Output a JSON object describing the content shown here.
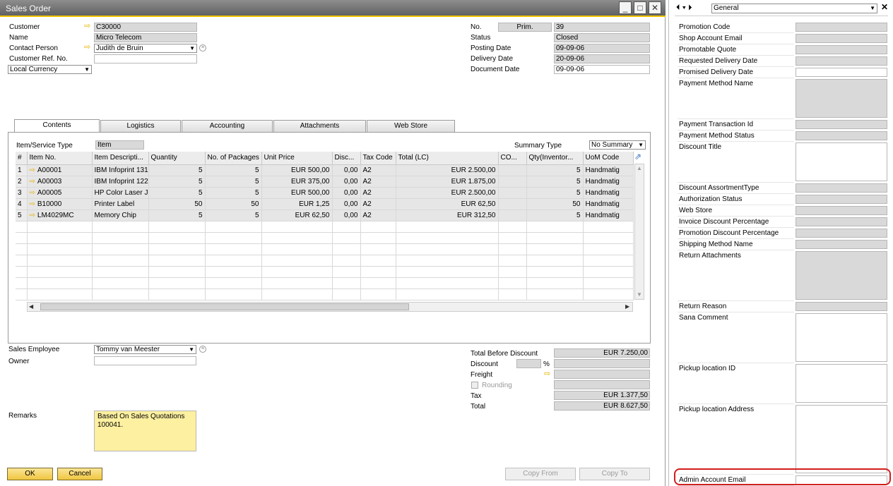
{
  "window": {
    "title": "Sales Order"
  },
  "header_left": {
    "customer_label": "Customer",
    "customer_value": "C30000",
    "name_label": "Name",
    "name_value": "Micro Telecom",
    "contact_label": "Contact Person",
    "contact_value": "Judith de Bruin",
    "ref_label": "Customer Ref. No.",
    "ref_value": "",
    "currency_value": "Local Currency"
  },
  "header_right": {
    "no_label": "No.",
    "series_value": "Prim.",
    "no_value": "39",
    "status_label": "Status",
    "status_value": "Closed",
    "posting_label": "Posting Date",
    "posting_value": "09-09-06",
    "delivery_label": "Delivery Date",
    "delivery_value": "20-09-06",
    "document_label": "Document Date",
    "document_value": "09-09-06"
  },
  "tabs": [
    {
      "label": "Contents"
    },
    {
      "label": "Logistics"
    },
    {
      "label": "Accounting"
    },
    {
      "label": "Attachments"
    },
    {
      "label": "Web Store"
    }
  ],
  "contents": {
    "item_type_label": "Item/Service Type",
    "item_type_value": "Item",
    "summary_label": "Summary Type",
    "summary_value": "No Summary",
    "columns": [
      "#",
      "Item No.",
      "Item Descripti...",
      "Quantity",
      "No. of Packages",
      "Unit Price",
      "Disc...",
      "Tax Code",
      "Total (LC)",
      "CO...",
      "Qty(Inventor...",
      "UoM Code"
    ],
    "rows": [
      {
        "n": "1",
        "item": "A00001",
        "desc": "IBM Infoprint 131",
        "qty": "5",
        "pkg": "5",
        "price": "EUR 500,00",
        "disc": "0,00",
        "tax": "A2",
        "total": "EUR 2.500,00",
        "co": "",
        "inv": "5",
        "uom": "Handmatig"
      },
      {
        "n": "2",
        "item": "A00003",
        "desc": "IBM Infoprint 122",
        "qty": "5",
        "pkg": "5",
        "price": "EUR 375,00",
        "disc": "0,00",
        "tax": "A2",
        "total": "EUR 1.875,00",
        "co": "",
        "inv": "5",
        "uom": "Handmatig"
      },
      {
        "n": "3",
        "item": "A00005",
        "desc": "HP Color Laser Je",
        "qty": "5",
        "pkg": "5",
        "price": "EUR 500,00",
        "disc": "0,00",
        "tax": "A2",
        "total": "EUR 2.500,00",
        "co": "",
        "inv": "5",
        "uom": "Handmatig"
      },
      {
        "n": "4",
        "item": "B10000",
        "desc": "Printer Label",
        "qty": "50",
        "pkg": "50",
        "price": "EUR 1,25",
        "disc": "0,00",
        "tax": "A2",
        "total": "EUR 62,50",
        "co": "",
        "inv": "50",
        "uom": "Handmatig"
      },
      {
        "n": "5",
        "item": "LM4029MC",
        "desc": "Memory Chip",
        "qty": "5",
        "pkg": "5",
        "price": "EUR 62,50",
        "disc": "0,00",
        "tax": "A2",
        "total": "EUR 312,50",
        "co": "",
        "inv": "5",
        "uom": "Handmatig"
      }
    ]
  },
  "footer_left": {
    "employee_label": "Sales Employee",
    "employee_value": "Tommy van Meester",
    "owner_label": "Owner",
    "owner_value": "",
    "remarks_label": "Remarks",
    "remarks_value": "Based On Sales Quotations 100041."
  },
  "totals": {
    "before_label": "Total Before Discount",
    "before_value": "EUR 7.250,00",
    "discount_label": "Discount",
    "percent_sign": "%",
    "freight_label": "Freight",
    "rounding_label": "Rounding",
    "tax_label": "Tax",
    "tax_value": "EUR 1.377,50",
    "total_label": "Total",
    "total_value": "EUR 8.627,50"
  },
  "buttons": {
    "ok": "OK",
    "cancel": "Cancel",
    "copy_from": "Copy From",
    "copy_to": "Copy To"
  },
  "udf": {
    "category": "General",
    "fields": [
      {
        "label": "Promotion Code",
        "h": 13,
        "white": false
      },
      {
        "label": "Shop Account Email",
        "h": 13,
        "white": false
      },
      {
        "label": "Promotable Quote",
        "h": 13,
        "white": false
      },
      {
        "label": "Requested Delivery Date",
        "h": 13,
        "white": false
      },
      {
        "label": "Promised Delivery Date",
        "h": 13,
        "white": true
      },
      {
        "label": "Payment Method Name",
        "h": 55,
        "white": false
      },
      {
        "label": "Payment Transaction Id",
        "h": 13,
        "white": false
      },
      {
        "label": "Payment Method Status",
        "h": 13,
        "white": false
      },
      {
        "label": "Discount Title",
        "h": 55,
        "white": true
      },
      {
        "label": "Discount AssortmentType",
        "h": 13,
        "white": false
      },
      {
        "label": "Authorization Status",
        "h": 13,
        "white": false
      },
      {
        "label": "Web Store",
        "h": 13,
        "white": false
      },
      {
        "label": "Invoice Discount Percentage",
        "h": 13,
        "white": false
      },
      {
        "label": "Promotion Discount Percentage",
        "h": 13,
        "white": false
      },
      {
        "label": "Shipping Method Name",
        "h": 13,
        "white": false
      },
      {
        "label": "Return Attachments",
        "h": 69,
        "white": false
      },
      {
        "label": "Return Reason",
        "h": 13,
        "white": false
      },
      {
        "label": "Sana Comment",
        "h": 69,
        "white": true
      },
      {
        "label": "Pickup location ID",
        "h": 55,
        "white": true
      },
      {
        "label": "Pickup location Address",
        "h": 97,
        "white": true
      },
      {
        "label": "Admin Account Email",
        "h": 13,
        "white": true
      }
    ]
  }
}
